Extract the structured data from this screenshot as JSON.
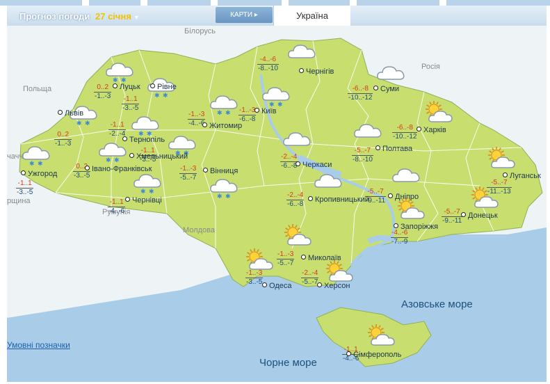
{
  "header": {
    "title": "Прогноз погоди",
    "date": "27 січня",
    "maps_button": "КАРТИ",
    "region_tab": "Україна"
  },
  "countries": [
    "Білорусь",
    "Польща",
    "Росія",
    "Румунія",
    "Молдова",
    "чаччи",
    "рщина"
  ],
  "seas": [
    "Азовське море",
    "Чорне море"
  ],
  "legend_link": "Умовні позначки",
  "colors": {
    "land": "#c8de6e",
    "water": "#a9cde9",
    "border": "#ffffff",
    "title_bar": "#c9dcec",
    "date": "#f2c200"
  },
  "cities": [
    {
      "name": "Луцьк",
      "day": "0..2",
      "night": "-1..-3",
      "icon": "cloud-snow-icon"
    },
    {
      "name": "Рівне",
      "day": "-1..1",
      "night": "-3..-5",
      "icon": "cloud-snow-icon"
    },
    {
      "name": "Львів",
      "day": "0..2",
      "night": "-1..-3",
      "icon": "cloud-snow-icon"
    },
    {
      "name": "Тернопіль",
      "day": "-1..1",
      "night": "-2..-4",
      "icon": "cloud-snow-icon"
    },
    {
      "name": "Житомир",
      "day": "-1..-3",
      "night": "-4..-6",
      "icon": "cloud-snow-icon"
    },
    {
      "name": "Київ",
      "day": "-1..-3",
      "night": "-6..-8",
      "icon": "cloud-snow-icon"
    },
    {
      "name": "Чернігів",
      "day": "-4..-6",
      "night": "-8..-10",
      "icon": "cloud-icon"
    },
    {
      "name": "Суми",
      "day": "-6..-8",
      "night": "-10..-12",
      "icon": "cloud-icon"
    },
    {
      "name": "Харків",
      "day": "-6..-8",
      "night": "-10..-12",
      "icon": "sun-cloud-icon"
    },
    {
      "name": "Полтава",
      "day": "-5..-7",
      "night": "-8..-10",
      "icon": "cloud-icon"
    },
    {
      "name": "Хмельницький",
      "day": "-1..1",
      "night": "-3..-5",
      "icon": "cloud-snow-icon"
    },
    {
      "name": "Ужгород",
      "day": "-1..1",
      "night": "-3..-5",
      "icon": "cloud-snow-icon"
    },
    {
      "name": "Івано-Франківськ",
      "day": "0..2",
      "night": "-3..-5",
      "icon": "cloud-snow-icon"
    },
    {
      "name": "Вінниця",
      "day": "-1..-3",
      "night": "-5..-7",
      "icon": "cloud-snow-icon"
    },
    {
      "name": "Чернівці",
      "day": "-1..1",
      "night": "-4..-6",
      "icon": "cloud-snow-icon"
    },
    {
      "name": "Черкаси",
      "day": "-2..-4",
      "night": "-6..-8",
      "icon": "cloud-icon"
    },
    {
      "name": "Кропивницький",
      "day": "-2..-4",
      "night": "-6..-8",
      "icon": "cloud-icon"
    },
    {
      "name": "Дніпро",
      "day": "-5..-7",
      "night": "-9..-11",
      "icon": "cloud-icon"
    },
    {
      "name": "Запоріжжя",
      "day": "-4..-6",
      "night": "-7..-9",
      "icon": "sun-cloud-icon"
    },
    {
      "name": "Луганськ",
      "day": "-5..-7",
      "night": "-11..-13",
      "icon": "sun-cloud-icon"
    },
    {
      "name": "Донецьк",
      "day": "-5..-7",
      "night": "-9..-11",
      "icon": "sun-cloud-icon"
    },
    {
      "name": "Миколаїв",
      "day": "-1..-3",
      "night": "-5..-7",
      "icon": "sun-cloud-icon"
    },
    {
      "name": "Одеса",
      "day": "-1..-3",
      "night": "-3..-5",
      "icon": "sun-cloud-icon"
    },
    {
      "name": "Херсон",
      "day": "-2..-4",
      "night": "-5..-7",
      "icon": "sun-cloud-icon"
    },
    {
      "name": "Сімферополь",
      "day": "-1..1",
      "night": "-4..-6",
      "icon": "sun-cloud-icon"
    }
  ]
}
